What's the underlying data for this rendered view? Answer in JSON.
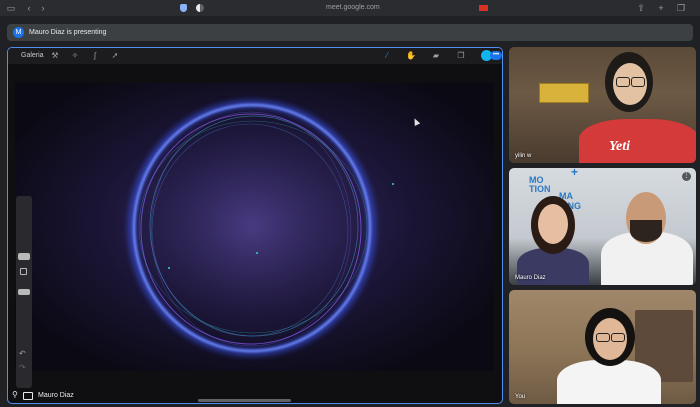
{
  "browser": {
    "url": "meet.google.com"
  },
  "meeting": {
    "presenting_banner": "Mauro Diaz is presenting",
    "presenter_initial": "M"
  },
  "main_screen": {
    "app_menu": "Galeria",
    "presenter_name": "Mauro Diaz"
  },
  "participants": [
    {
      "name": "yilin w"
    },
    {
      "name": "Mauro Diaz"
    },
    {
      "name": "You"
    }
  ],
  "tile2": {
    "wall_text_1": "MO",
    "wall_text_2": "TION",
    "wall_text_3": "MA",
    "wall_text_4": "PING",
    "plus": "+"
  },
  "tile1": {
    "shirt_text": "Yeti"
  },
  "colors": {
    "accent": "#1a73e8",
    "active_border": "#4f8ff0",
    "brush_color": "#10b5f0"
  },
  "icons": {
    "back": "chevron-left-icon",
    "forward": "chevron-right-icon",
    "sidebar": "sidebar-icon",
    "pin": "pin-icon",
    "presentation": "present-screen-icon"
  }
}
